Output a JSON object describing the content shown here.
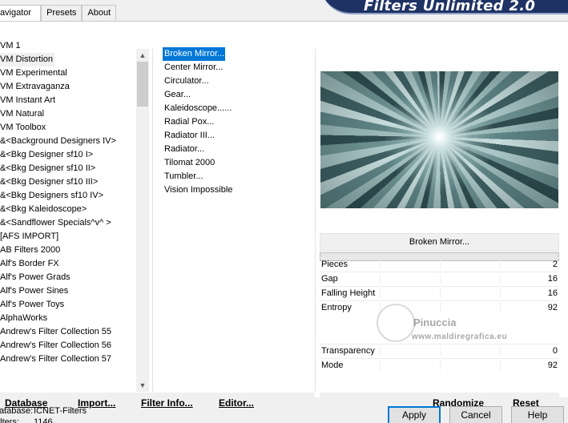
{
  "tabs": [
    "Navigator",
    "Presets",
    "About"
  ],
  "banner": "Filters Unlimited 2.0",
  "categories": [
    "VM 1",
    "VM Distortion",
    "VM Experimental",
    "VM Extravaganza",
    "VM Instant Art",
    "VM Natural",
    "VM Toolbox",
    "&<Background Designers IV>",
    "&<Bkg Designer sf10 I>",
    "&<Bkg Designer sf10 II>",
    "&<Bkg Designer sf10 III>",
    "&<Bkg Designers sf10 IV>",
    "&<Bkg Kaleidoscope>",
    "&<Sandflower Specials^v^ >",
    "[AFS IMPORT]",
    "AB Filters 2000",
    "Alf's Border FX",
    "Alf's Power Grads",
    "Alf's Power Sines",
    "Alf's Power Toys",
    "AlphaWorks",
    "Andrew's Filter Collection 55",
    "Andrew's Filter Collection 56",
    "Andrew's Filter Collection 57"
  ],
  "filters": [
    "Broken Mirror...",
    "Center Mirror...",
    "Circulator...",
    "Gear...",
    "Kaleidoscope......",
    "Radial Pox...",
    "Radiator III...",
    "Radiator...",
    "Tilomat 2000",
    "Tumbler...",
    "Vision Impossible"
  ],
  "selected_filter": "Broken Mirror...",
  "params": [
    {
      "label": "Pieces",
      "value": "2"
    },
    {
      "label": "Gap",
      "value": "16"
    },
    {
      "label": "Falling Height",
      "value": "16"
    },
    {
      "label": "Entropy",
      "value": "92"
    },
    {
      "label": "Transparency",
      "value": "0"
    },
    {
      "label": "Mode",
      "value": "92"
    }
  ],
  "watermark": {
    "name": "Pinuccia",
    "url": "www.maldiregrafica.eu"
  },
  "toolbar_left": {
    "database": "Database",
    "import": "Import...",
    "filter_info": "Filter Info...",
    "editor": "Editor..."
  },
  "toolbar_right": {
    "randomize": "Randomize",
    "reset": "Reset"
  },
  "info": {
    "db_label": "Database:",
    "db_value": "ICNET-Filters",
    "filters_label": "Filters:",
    "filters_value": "1146"
  },
  "buttons": {
    "apply": "Apply",
    "cancel": "Cancel",
    "help": "Help"
  },
  "scroll_arrows": {
    "up": "▲",
    "down": "▼"
  }
}
